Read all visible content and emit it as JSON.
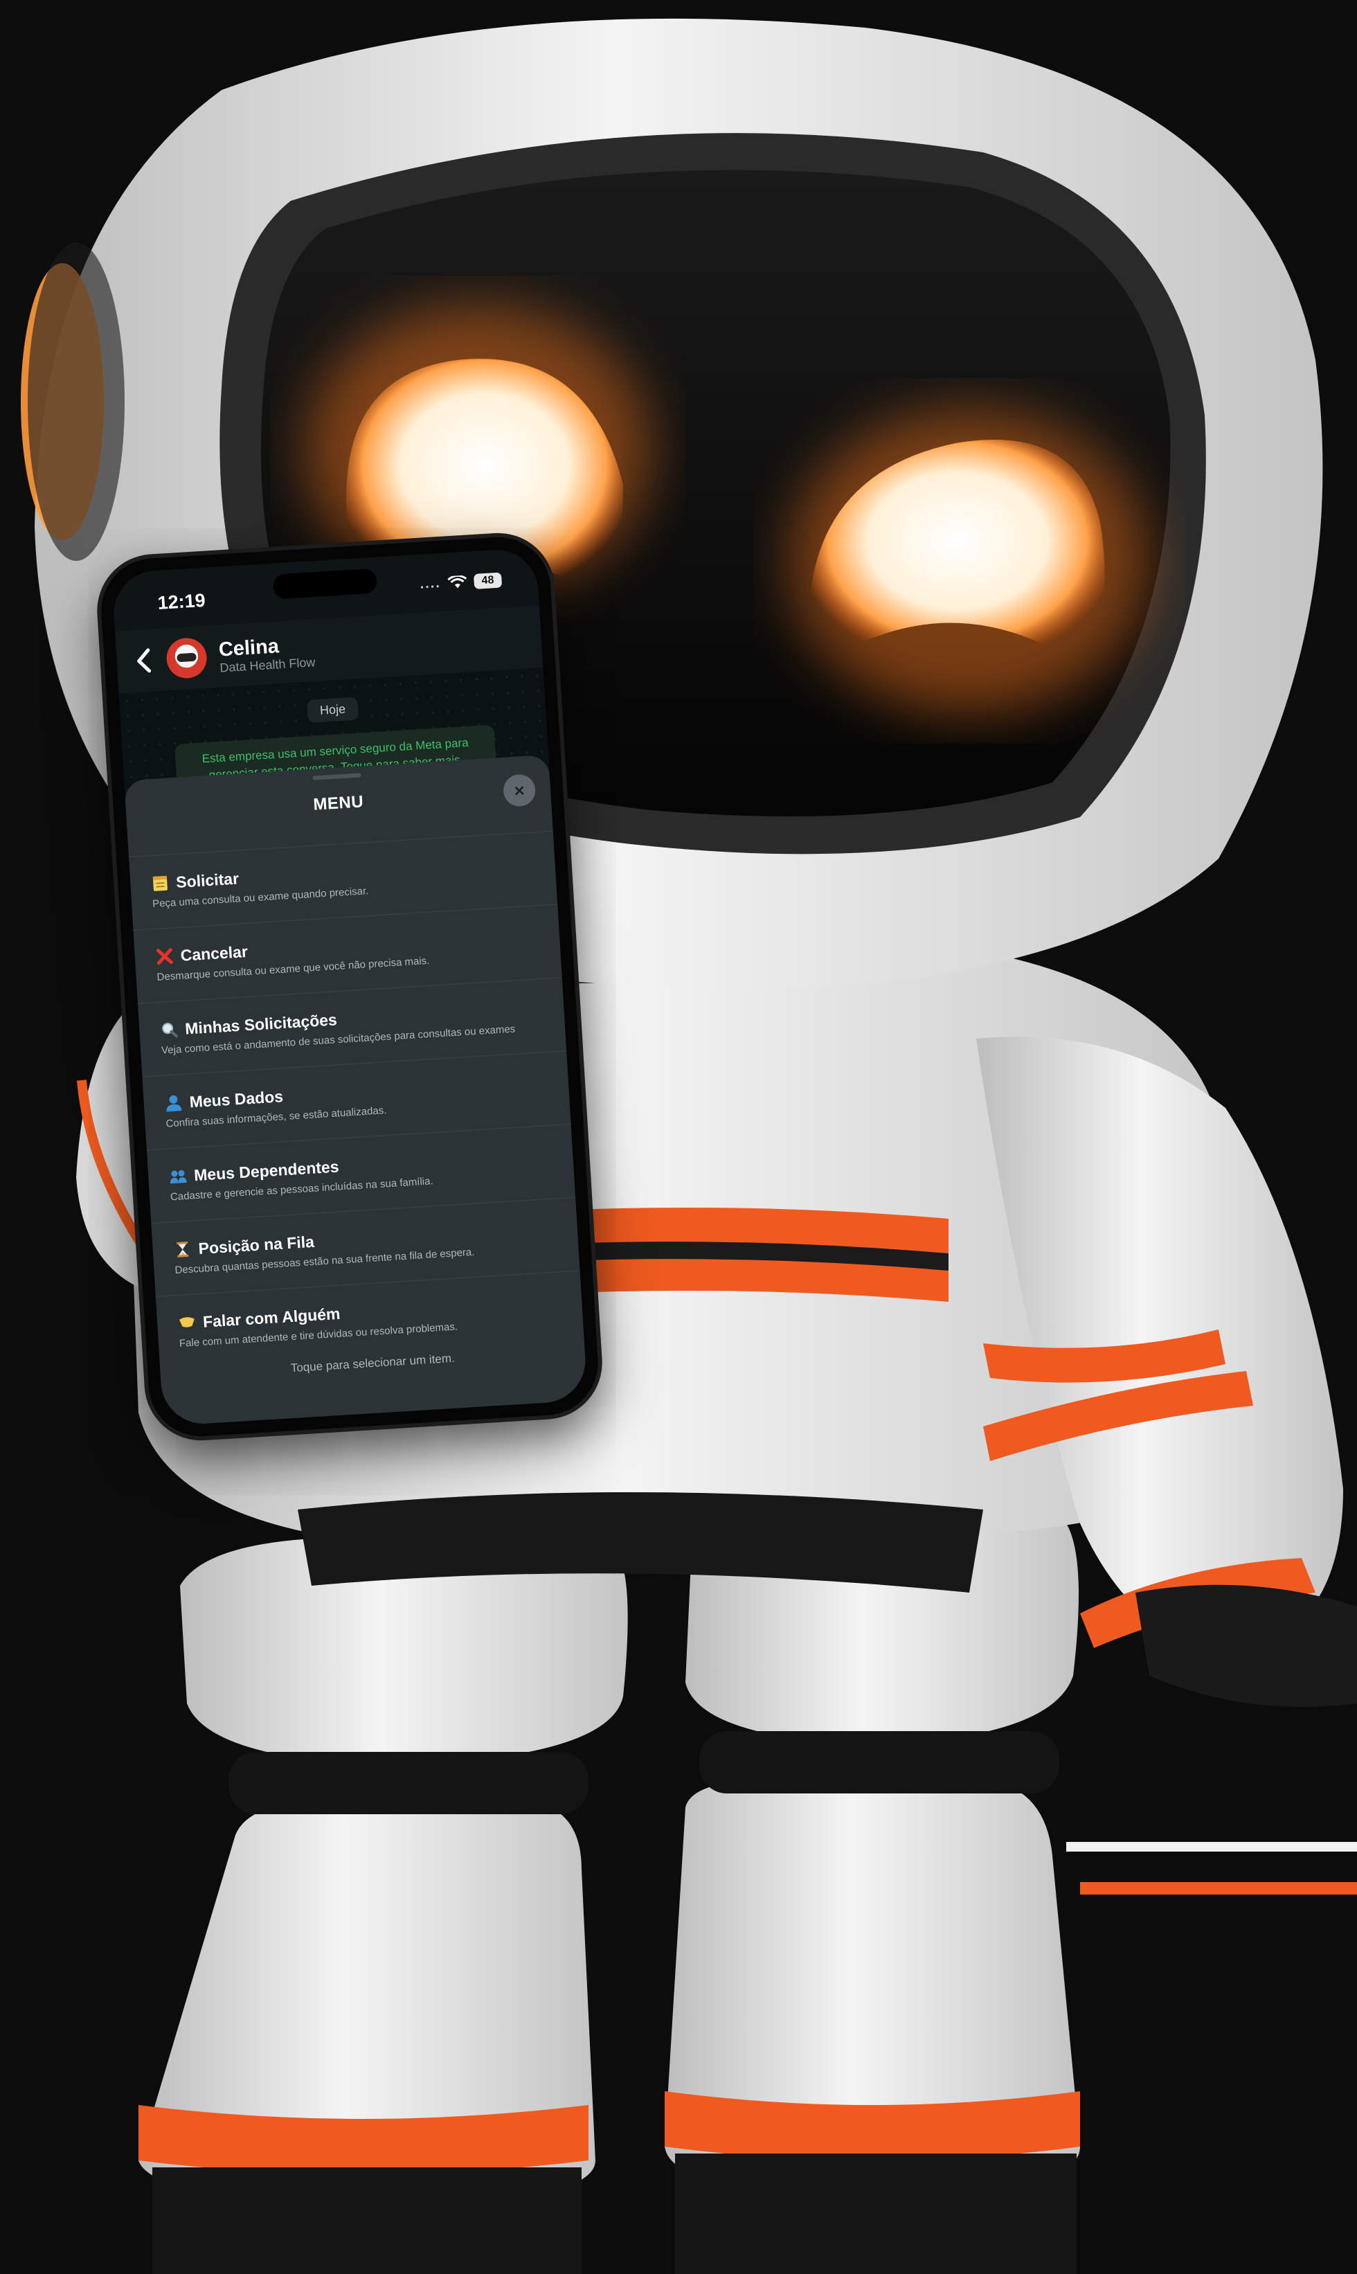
{
  "status_bar": {
    "time": "12:19",
    "signal": "....",
    "battery": "48"
  },
  "chat": {
    "contact_name": "Celina",
    "contact_subtitle": "Data Health Flow",
    "date_chip": "Hoje",
    "system_message": "Esta empresa usa um serviço seguro da Meta para gerenciar esta conversa. Toque para saber mais."
  },
  "menu": {
    "title": "MENU",
    "close_label": "×",
    "items": [
      {
        "icon": "notepad-icon",
        "title": "Solicitar",
        "description": "Peça uma consulta ou exame quando precisar."
      },
      {
        "icon": "cross-mark-icon",
        "title": "Cancelar",
        "description": "Desmarque consulta ou exame que você não precisa mais."
      },
      {
        "icon": "magnifier-icon",
        "title": "Minhas Solicitações",
        "description": "Veja como está o andamento de suas solicitações para consultas ou exames"
      },
      {
        "icon": "user-icon",
        "title": "Meus Dados",
        "description": "Confira suas informações, se estão atualizadas."
      },
      {
        "icon": "users-icon",
        "title": "Meus Dependentes",
        "description": "Cadastre e gerencie as pessoas incluídas na sua família."
      },
      {
        "icon": "hourglass-icon",
        "title": "Posição na Fila",
        "description": "Descubra quantas pessoas estão na sua frente na fila de espera."
      },
      {
        "icon": "speech-icon",
        "title": "Falar com Alguém",
        "description": "Fale com um atendente e tire dúvidas ou resolva problemas."
      }
    ],
    "footer_hint": "Toque para selecionar um item."
  },
  "colors": {
    "robot_white": "#f2f2f2",
    "robot_dark": "#1a1a1a",
    "accent_orange": "#ee5a1f",
    "eye_glow": "#ffb347",
    "sheet_bg": "#2c3336",
    "whatsapp_green": "#3fbf6a"
  }
}
